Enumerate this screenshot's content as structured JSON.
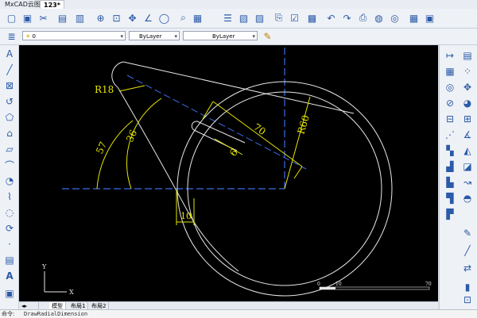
{
  "window": {
    "app_name": "MxCAD云图",
    "tab_name": "123*"
  },
  "layer_bar": {
    "layer_value": "0",
    "color_value": "ByLayer",
    "linetype_value": "ByLayer"
  },
  "layout_tabs": [
    "模型",
    "布局1",
    "布局2"
  ],
  "command_line": {
    "label": "命令:",
    "text": "DrawRadialDimension"
  },
  "drawing": {
    "dimensions": {
      "r18": "R18",
      "d57": "57",
      "d36": "36",
      "d70": "70",
      "r60": "R60",
      "d6": "6",
      "d10": "10"
    },
    "ucs": {
      "x": "X",
      "y": "Y"
    },
    "scale_bar": {
      "start": "0",
      "mid": "10",
      "end": "70"
    }
  },
  "colors": {
    "dimension": "#e6e600",
    "geometry": "#e8e8e8",
    "centerline": "#3a6ee8",
    "canvas": "#000000"
  },
  "icons": {
    "toolbar": [
      "new-file-icon",
      "open-icon",
      "cut-icon",
      "save-icon",
      "save-as-icon",
      "zoom-icon",
      "zoom-extents-icon",
      "pan-icon",
      "measure-icon",
      "circle-icon",
      "query-icon",
      "table-icon",
      "list-icon",
      "layer-icon",
      "pdf-icon",
      "check-icon",
      "print-icon",
      "undo-icon",
      "redo-icon",
      "printer-icon",
      "globe-icon",
      "calculator-icon",
      "image-icon"
    ],
    "left": [
      "text-icon",
      "line-icon",
      "rectangle-icon",
      "arc-icon",
      "polygon-icon",
      "spline-icon",
      "hatch-icon",
      "circle-draw-icon",
      "polyline-icon",
      "revcloud-icon",
      "ellipse-icon",
      "point-icon",
      "block-icon",
      "mtext-icon",
      "text-style-icon",
      "image-insert-icon"
    ],
    "right": [
      "move-icon",
      "copy-icon",
      "offset-icon",
      "rotate-icon",
      "scale-icon",
      "mirror-icon",
      "trim-icon",
      "extend-icon",
      "fillet-icon",
      "chamfer-icon",
      "array-icon",
      "stretch-icon",
      "explode-icon",
      "join-icon",
      "break-icon",
      "align-icon"
    ]
  }
}
